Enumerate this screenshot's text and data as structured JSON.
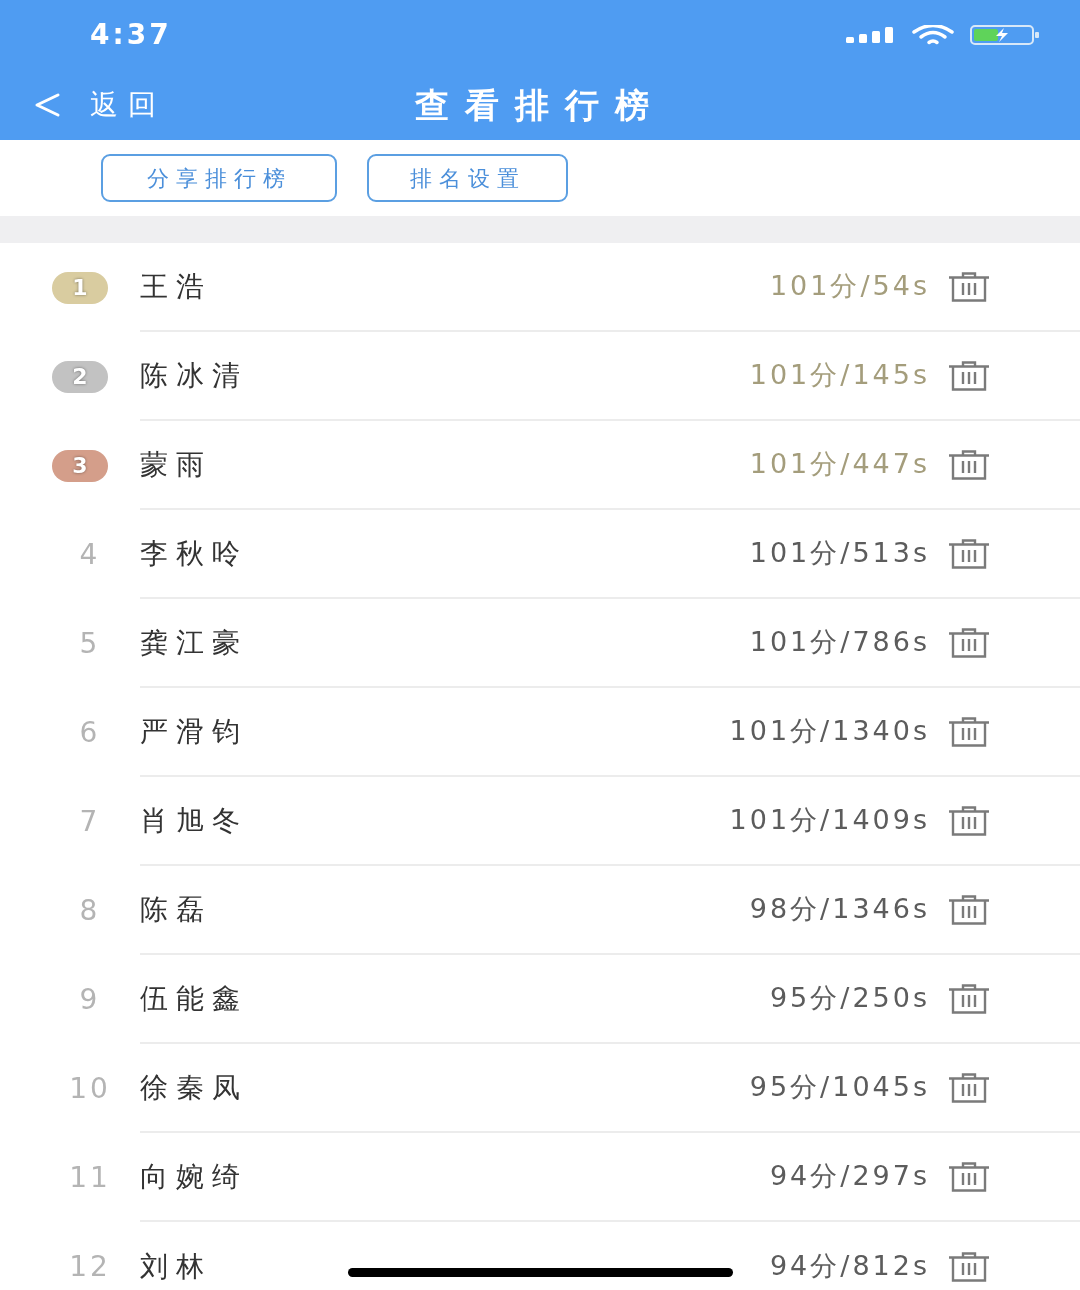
{
  "status_bar": {
    "time": "4:37"
  },
  "nav_bar": {
    "back_label": "返回",
    "title": "查看排行榜"
  },
  "actions": [
    {
      "label": "分享排行榜"
    },
    {
      "label": "排名设置"
    }
  ],
  "rows": [
    {
      "rank": "1",
      "kind": "medal",
      "color": "#d9cca0",
      "name": "王浩",
      "score": "101分/54s"
    },
    {
      "rank": "2",
      "kind": "medal",
      "color": "#c2c2c2",
      "name": "陈冰清",
      "score": "101分/145s"
    },
    {
      "rank": "3",
      "kind": "medal",
      "color": "#d49e8a",
      "name": "蒙雨",
      "score": "101分/447s"
    },
    {
      "rank": "4",
      "kind": "plain",
      "name": "李秋呤",
      "score": "101分/513s"
    },
    {
      "rank": "5",
      "kind": "plain",
      "name": "龚江豪",
      "score": "101分/786s"
    },
    {
      "rank": "6",
      "kind": "plain",
      "name": "严滑钧",
      "score": "101分/1340s"
    },
    {
      "rank": "7",
      "kind": "plain",
      "name": "肖旭冬",
      "score": "101分/1409s"
    },
    {
      "rank": "8",
      "kind": "plain",
      "name": "陈磊",
      "score": "98分/1346s"
    },
    {
      "rank": "9",
      "kind": "plain",
      "name": "伍能鑫",
      "score": "95分/250s"
    },
    {
      "rank": "10",
      "kind": "plain",
      "name": "徐秦凤",
      "score": "95分/1045s"
    },
    {
      "rank": "11",
      "kind": "plain",
      "name": "向婉绮",
      "score": "94分/297s"
    },
    {
      "rank": "12",
      "kind": "plain",
      "name": "刘林",
      "score": "94分/812s"
    }
  ]
}
